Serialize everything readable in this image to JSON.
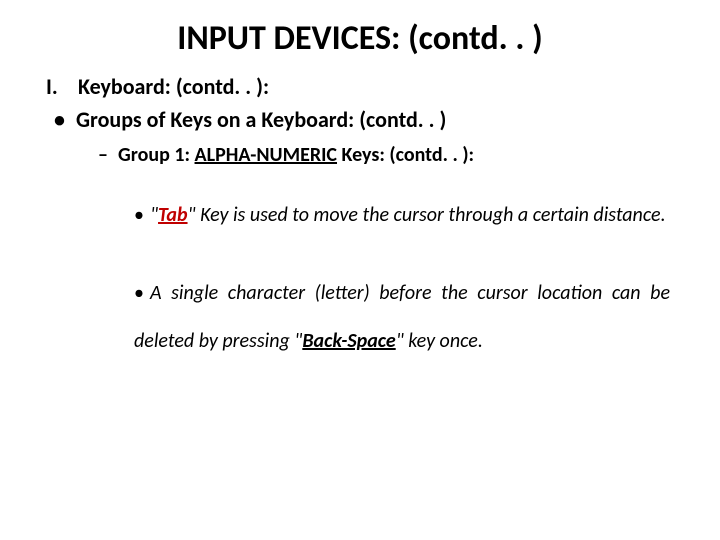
{
  "title": "INPUT DEVICES: (contd. . )",
  "level1": {
    "marker": "I.",
    "text": "Keyboard: (contd. . ):"
  },
  "level2": {
    "bullet": "•",
    "text": "Groups of Keys on a Keyboard: (contd. . )"
  },
  "level3": {
    "dash": "–",
    "prefix": "Group 1: ",
    "keys": "ALPHA-NUMERIC",
    "suffix": " Keys: (contd. . ):"
  },
  "bullet4a": {
    "dot": "•",
    "q1": "\"",
    "tab": "Tab",
    "q2": "\" ",
    "rest": "Key is used to move the cursor through a certain distance."
  },
  "bullet4b": {
    "dot": "•",
    "part1": "A single character (letter) before the cursor location can be deleted by pressing \"",
    "back": "Back-Space",
    "part2": "\" key once."
  }
}
